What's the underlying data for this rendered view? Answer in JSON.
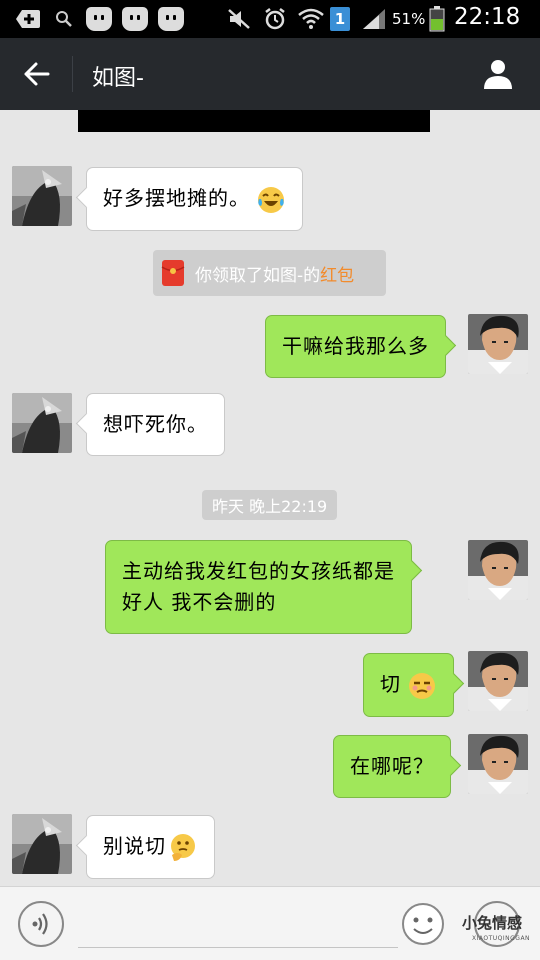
{
  "status_bar": {
    "battery_percent": "51%",
    "time": "22:18",
    "sim_badge": "1"
  },
  "header": {
    "title": "如图-"
  },
  "messages": [
    {
      "side": "left",
      "text": "好多摆地摊的。",
      "emoji": "laugh-cry-emoji"
    },
    {
      "type": "system",
      "prefix": "你领取了如图-的",
      "highlight": "红包",
      "icon": "red-envelope-icon"
    },
    {
      "side": "right",
      "text": "干嘛给我那么多"
    },
    {
      "side": "left",
      "text": "想吓死你。"
    },
    {
      "type": "timestamp",
      "text": "昨天 晚上22:19"
    },
    {
      "side": "right",
      "lines": [
        "主动给我发红包的女孩纸都是",
        "好人 我不会删的"
      ]
    },
    {
      "side": "right",
      "text": "切",
      "emoji": "unamused-emoji"
    },
    {
      "side": "right",
      "text": "在哪呢？"
    },
    {
      "side": "left",
      "text": "别说切",
      "emoji": "thinking-emoji"
    }
  ],
  "watermark": {
    "text": "小兔情感",
    "sub": "XIAOTUQINGGAN"
  },
  "colors": {
    "header_bg": "#26292d",
    "chat_bg": "#e6e6e6",
    "sent_bubble": "#a0e75a",
    "received_bubble": "#ffffff",
    "red_packet_highlight": "#f28b2c"
  }
}
